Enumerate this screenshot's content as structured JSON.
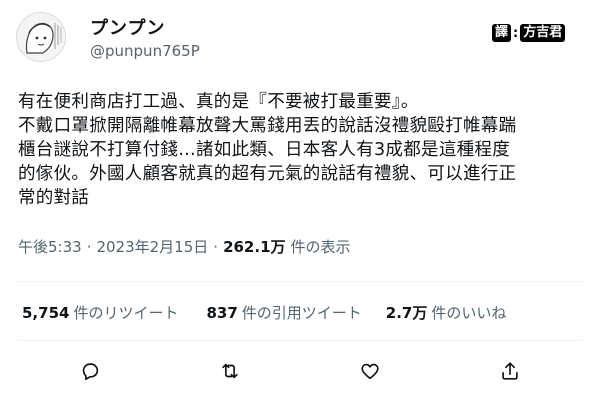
{
  "author": {
    "display_name": "プンプン",
    "handle": "@punpun765P",
    "avatar_icon": "avatar-illustration"
  },
  "translator_badge": {
    "label": "譯",
    "name": "方吉君"
  },
  "tweet": {
    "lines": [
      "有在便利商店打工過、真的是『不要被打最重要』。",
      "不戴口罩掀開隔離帷幕放聲大罵錢用丟的說話沒禮貌毆打帷幕踹",
      "櫃台謎說不打算付錢…諸如此類、日本客人有3成都是這種程度",
      "的傢伙。外國人顧客就真的超有元氣的說話有禮貌、可以進行正",
      "常的對話"
    ],
    "time": "午後5:33",
    "dot1": "·",
    "date": "2023年2月15日",
    "dot2": "·",
    "views_count": "262.1万",
    "views_label": "件の表示"
  },
  "stats": {
    "retweets_count": "5,754",
    "retweets_label": "件のリツイート",
    "quotes_count": "837",
    "quotes_label": "件の引用ツイート",
    "likes_count": "2.7万",
    "likes_label": "件のいいね"
  },
  "actions": {
    "reply_icon": "reply-icon",
    "retweet_icon": "retweet-icon",
    "like_icon": "like-icon",
    "share_icon": "share-icon"
  },
  "colors": {
    "text": "#0f1419",
    "secondary": "#536471",
    "divider": "#eff3f4",
    "background": "#ffffff"
  }
}
